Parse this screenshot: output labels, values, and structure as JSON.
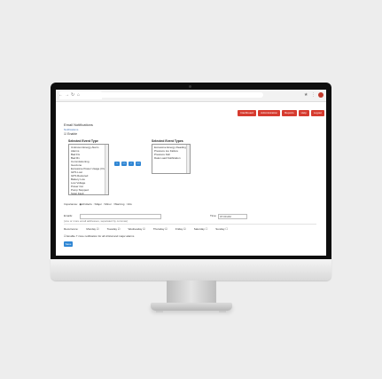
{
  "browser": {
    "nav_back": "←",
    "nav_forward": "→",
    "nav_reload": "↻",
    "nav_home": "⌂",
    "ext_1": "★",
    "ext_2": "⋮"
  },
  "topnav": {
    "items": [
      "Dashboard",
      "Administration",
      "Reports",
      "Help",
      "Logout"
    ]
  },
  "page": {
    "title": "Email Notifications",
    "breadcrumb": "Notifications",
    "enable_label": "Enable"
  },
  "event_types": {
    "available_label": "Selected Event Type",
    "available": [
      "Unknown Energy Alarm",
      "Alarms",
      "Bad Fix",
      "Bad Rx",
      "Commissioning",
      "Geozone",
      "Excessive Power Usage (Over)",
      "GPS Lost",
      "GPS Restored",
      "Battery Low",
      "Low Voltage",
      "Power Cut",
      "Pump Stopped",
      "Solar Fault"
    ],
    "selected_label": "Selected Event Types",
    "selected": [
      "Excessive Energy Reading",
      "Pressure too Failure",
      "Pressure Fall",
      "Data Load Notification"
    ],
    "move_buttons": [
      ">",
      ">>",
      "<",
      "<<"
    ]
  },
  "importance": {
    "label": "Importance:",
    "options": [
      "All Alerts",
      "Major",
      "Minor",
      "Warning",
      "Info"
    ]
  },
  "email": {
    "label": "Emails:",
    "time_label": "Time:",
    "time_value": "07:00 AM",
    "hint": "(one or more email addresses, separated by commas)"
  },
  "days": {
    "label": "Recurrence:",
    "items": [
      "Monday",
      "Tuesday",
      "Wednesday",
      "Thursday",
      "Friday",
      "Saturday",
      "Sunday"
    ]
  },
  "options": {
    "notify_checkbox": "Enable 7 zone notification for all critical and major alarms"
  },
  "actions": {
    "save_label": "Save"
  },
  "colors": {
    "accent_red": "#d63b2f",
    "accent_blue": "#2f86d4"
  }
}
